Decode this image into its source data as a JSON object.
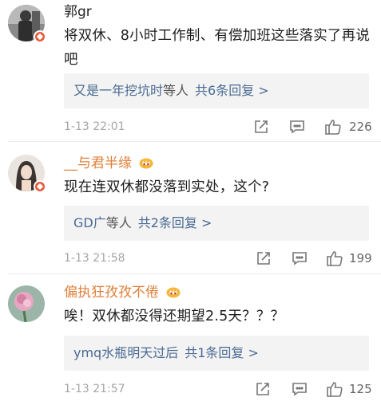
{
  "comments": [
    {
      "username": "郭gr",
      "text": "将双休、8小时工作制、有偿加班这些落实了再说吧",
      "reply_author": "又是一年挖坑时",
      "reply_suffix": "等人",
      "reply_count_text": "共6条回复 >",
      "time": "1-13 22:01",
      "likes": "226",
      "username_color": "#222222"
    },
    {
      "username": "__与君半缘",
      "text": "现在连双休都没落到实处，这个?",
      "reply_author": "GD广",
      "reply_suffix": "等人",
      "reply_count_text": "共2条回复 >",
      "time": "1-13 21:58",
      "likes": "199",
      "username_color": "#e1803a"
    },
    {
      "username": "偏执狂孜孜不倦",
      "text": "唉！双休都没得还期望2.5天？？？",
      "reply_author": "ymq水瓶明天过后",
      "reply_suffix": "",
      "reply_count_text": "共1条回复 >",
      "time": "1-13 21:57",
      "likes": "125",
      "username_color": "#e1803a"
    }
  ],
  "icons": {
    "share": "share-icon",
    "comment": "comment-icon",
    "like": "thumbs-up-icon",
    "vip": "crown-icon",
    "verified": "verified-badge-icon"
  },
  "colors": {
    "link": "#4a6a93",
    "vip_name": "#e1803a",
    "reply_bg": "#f3f3f3",
    "badge": "#e8583a"
  }
}
